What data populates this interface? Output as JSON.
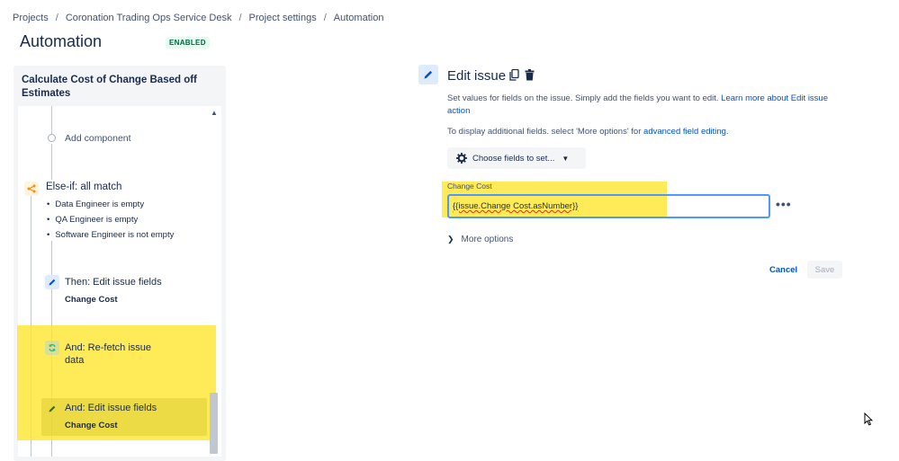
{
  "breadcrumb": [
    "Projects",
    "Coronation Trading Ops Service Desk",
    "Project settings",
    "Automation"
  ],
  "page": {
    "title": "Automation",
    "status_badge": "ENABLED"
  },
  "rule": {
    "name": "Calculate Cost of Change Based off Estimates",
    "add_component_label": "Add component",
    "else_if": {
      "label": "Else-if: all match",
      "conditions": [
        "Data Engineer is empty",
        "QA Engineer is empty",
        "Software Engineer is not empty"
      ]
    },
    "steps": [
      {
        "title": "Then: Edit issue fields",
        "subtitle": "Change Cost",
        "icon": "pencil-icon"
      },
      {
        "title": "And: Re-fetch issue data",
        "subtitle": "",
        "icon": "refresh-icon"
      },
      {
        "title": "And: Edit issue fields",
        "subtitle": "Change Cost",
        "icon": "pencil-icon",
        "selected": true
      }
    ]
  },
  "detail": {
    "title": "Edit issue",
    "description_text": "Set values for fields on the issue. Simply add the fields you want to edit.",
    "description_link": "Learn more about Edit issue action",
    "additional_text": "To display additional fields. select 'More options' for",
    "additional_link": "advanced field editing",
    "additional_suffix": ".",
    "choose_fields_label": "Choose fields to set...",
    "field": {
      "label": "Change Cost",
      "value": "{{issue.Change Cost.asNumber}}"
    },
    "more_options_label": "More options",
    "cancel_label": "Cancel",
    "save_label": "Save"
  },
  "colors": {
    "accent": "#0052cc",
    "highlight": "#ffe628",
    "enabled_badge": "#006644",
    "input_focus": "#4c9aff"
  }
}
